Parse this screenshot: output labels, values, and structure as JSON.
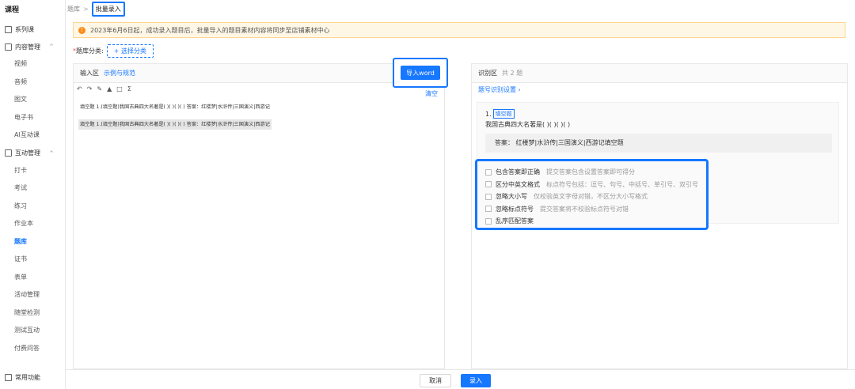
{
  "sidebar": {
    "title": "课程",
    "groups": [
      {
        "label": "系列课"
      },
      {
        "label": "内容管理",
        "chevron": "^"
      },
      {
        "label": "互动管理",
        "chevron": "^"
      }
    ],
    "content_items": [
      "视频",
      "音频",
      "图文",
      "电子书",
      "AI互动课"
    ],
    "interact_items": [
      "打卡",
      "考试",
      "练习",
      "作业本",
      "题库",
      "证书",
      "表单",
      "活动管理",
      "随堂检测",
      "测试互动",
      "付费问答"
    ],
    "bottom": "常用功能"
  },
  "breadcrumb": {
    "root": "题库",
    "sep": ">",
    "current": "批量录入"
  },
  "notice": {
    "icon": "!",
    "text": "2023年6月6日起，成功录入题目后，批量导入的题目素材内容将同步至店铺素材中心"
  },
  "category": {
    "required": "*",
    "label": "题库分类:",
    "button": "+ 选择分类"
  },
  "input_panel": {
    "title": "输入区",
    "link": "示例与规范",
    "import_button": "导入word",
    "clear": "清空",
    "toolbar": [
      "↶",
      "↷",
      "✎",
      "▲",
      "□",
      "Σ"
    ],
    "lines": [
      "填空题 1.(填空题)我国古典四大名著是( )( )( )( ) 答案：红楼梦|水浒传|三国演义|西游记",
      "填空题 1.(填空题)我国古典四大名著是( )( )( )( ) 答案：红楼梦|水浒传|三国演义|西游记"
    ]
  },
  "result_panel": {
    "title": "识别区",
    "count": "共 2 题",
    "settings_link": "题号识别设置 ›",
    "question": {
      "number": "1.",
      "tag": "填空题",
      "text": "我国古典四大名著是( )( )( )( )",
      "answer": "答案： 红楼梦|水浒传|三国演义|西游记填空题"
    },
    "options": [
      {
        "name": "包含答案即正确",
        "desc": "提交答案包含设置答案即可得分"
      },
      {
        "name": "区分中英文格式",
        "desc": "标点符号包括：逗号、句号、中括号、单引号、双引号"
      },
      {
        "name": "忽略大小写",
        "desc": "仅校验英文字母对错，不区分大小写格式"
      },
      {
        "name": "忽略标点符号",
        "desc": "提交答案将不校验标点符号对错"
      },
      {
        "name": "乱序匹配答案",
        "desc": ""
      }
    ]
  },
  "footer": {
    "cancel": "取消",
    "submit": "录入"
  },
  "colors": {
    "primary": "#1677ff",
    "notice_bg": "#fff7e6",
    "warn": "#fa8c16"
  }
}
